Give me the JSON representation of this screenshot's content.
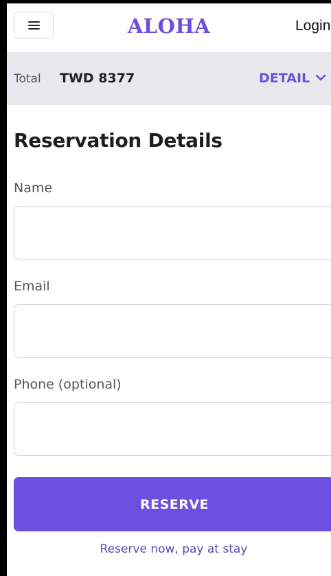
{
  "header": {
    "brand": "ALOHA",
    "login_label": "Login",
    "menu_icon": "hamburger-menu-icon"
  },
  "summary": {
    "total_label": "Total",
    "total_value": "TWD 8377",
    "detail_label": "DETAIL",
    "detail_icon": "chevron-down-icon"
  },
  "form": {
    "title": "Reservation Details",
    "fields": [
      {
        "label": "Name",
        "value": "",
        "placeholder": ""
      },
      {
        "label": "Email",
        "value": "",
        "placeholder": ""
      },
      {
        "label": "Phone (optional)",
        "value": "",
        "placeholder": ""
      }
    ],
    "submit_label": "RESERVE",
    "note": "Reserve now, pay at stay"
  },
  "colors": {
    "accent": "#6d4fe0",
    "summary_bg": "#ececf0",
    "note_text": "#5a45b8"
  }
}
